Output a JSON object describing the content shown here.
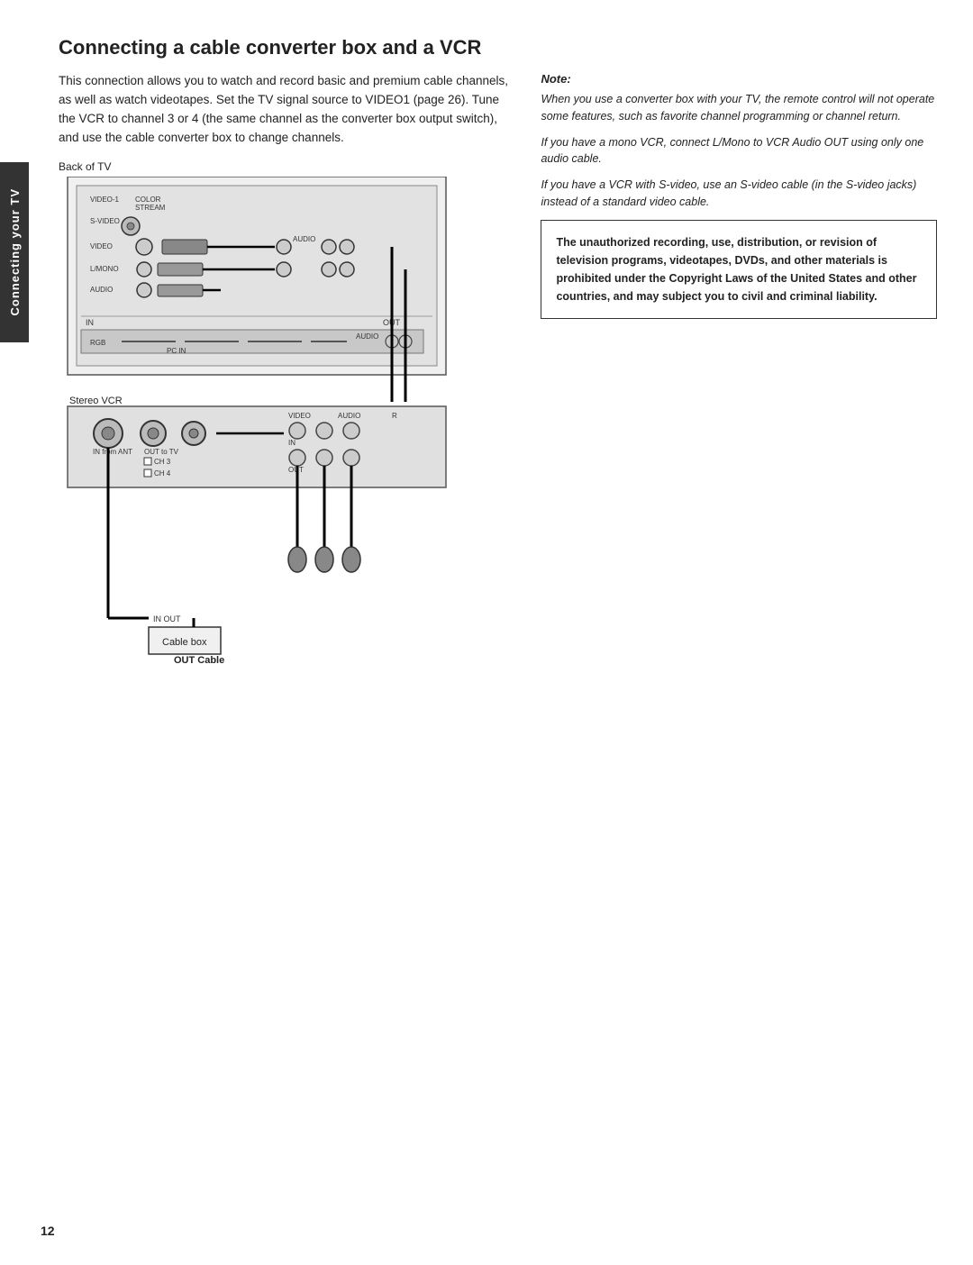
{
  "page": {
    "number": "12",
    "sidebar_label": "Connecting your TV"
  },
  "title": "Connecting a cable converter box and a VCR",
  "intro": "This connection allows you to watch and record basic and premium cable channels, as well as watch videotapes. Set the TV signal source to VIDEO1 (page 26). Tune the VCR to channel 3 or 4 (the same channel as the converter box output switch), and use the cable converter box to change channels.",
  "diagram": {
    "back_of_tv_label": "Back of TV",
    "stereo_vcr_label": "Stereo VCR",
    "cable_box_label": "Cable box",
    "out_cable_label": "OUT Cable",
    "in_label": "IN",
    "out_label": "OUT",
    "ch3_label": "CH 3",
    "ch4_label": "CH 4",
    "in_from_ant_label": "IN from ANT",
    "out_to_tv_label": "OUT to TV",
    "video_label": "VIDEO",
    "audio_label": "AUDIO",
    "l_mono_label": "L/MONO",
    "r_label": "R",
    "in_small": "IN",
    "out_small": "OUT",
    "video1_label": "VIDEO-1",
    "color_stream_label": "COLOR STREAM",
    "svideo_label": "S-VIDEO",
    "pc_in_label": "PC IN",
    "rgb_label": "RGB",
    "audio_pc_label": "AUDIO"
  },
  "note": {
    "heading": "Note:",
    "lines": [
      "When you use a converter box with your TV, the remote control will not operate some features, such as favorite channel programming or channel return.",
      "If you have a mono VCR, connect L/Mono to VCR Audio OUT using only one audio cable.",
      "If you have a VCR with S-video, use an S-video cable (in the S-video jacks) instead of a standard video cable."
    ]
  },
  "warning": {
    "text": "The unauthorized recording, use, distribution, or revision of television programs, videotapes, DVDs, and other materials is prohibited under the Copyright Laws of the United States and other countries, and may subject you to civil and criminal liability."
  }
}
